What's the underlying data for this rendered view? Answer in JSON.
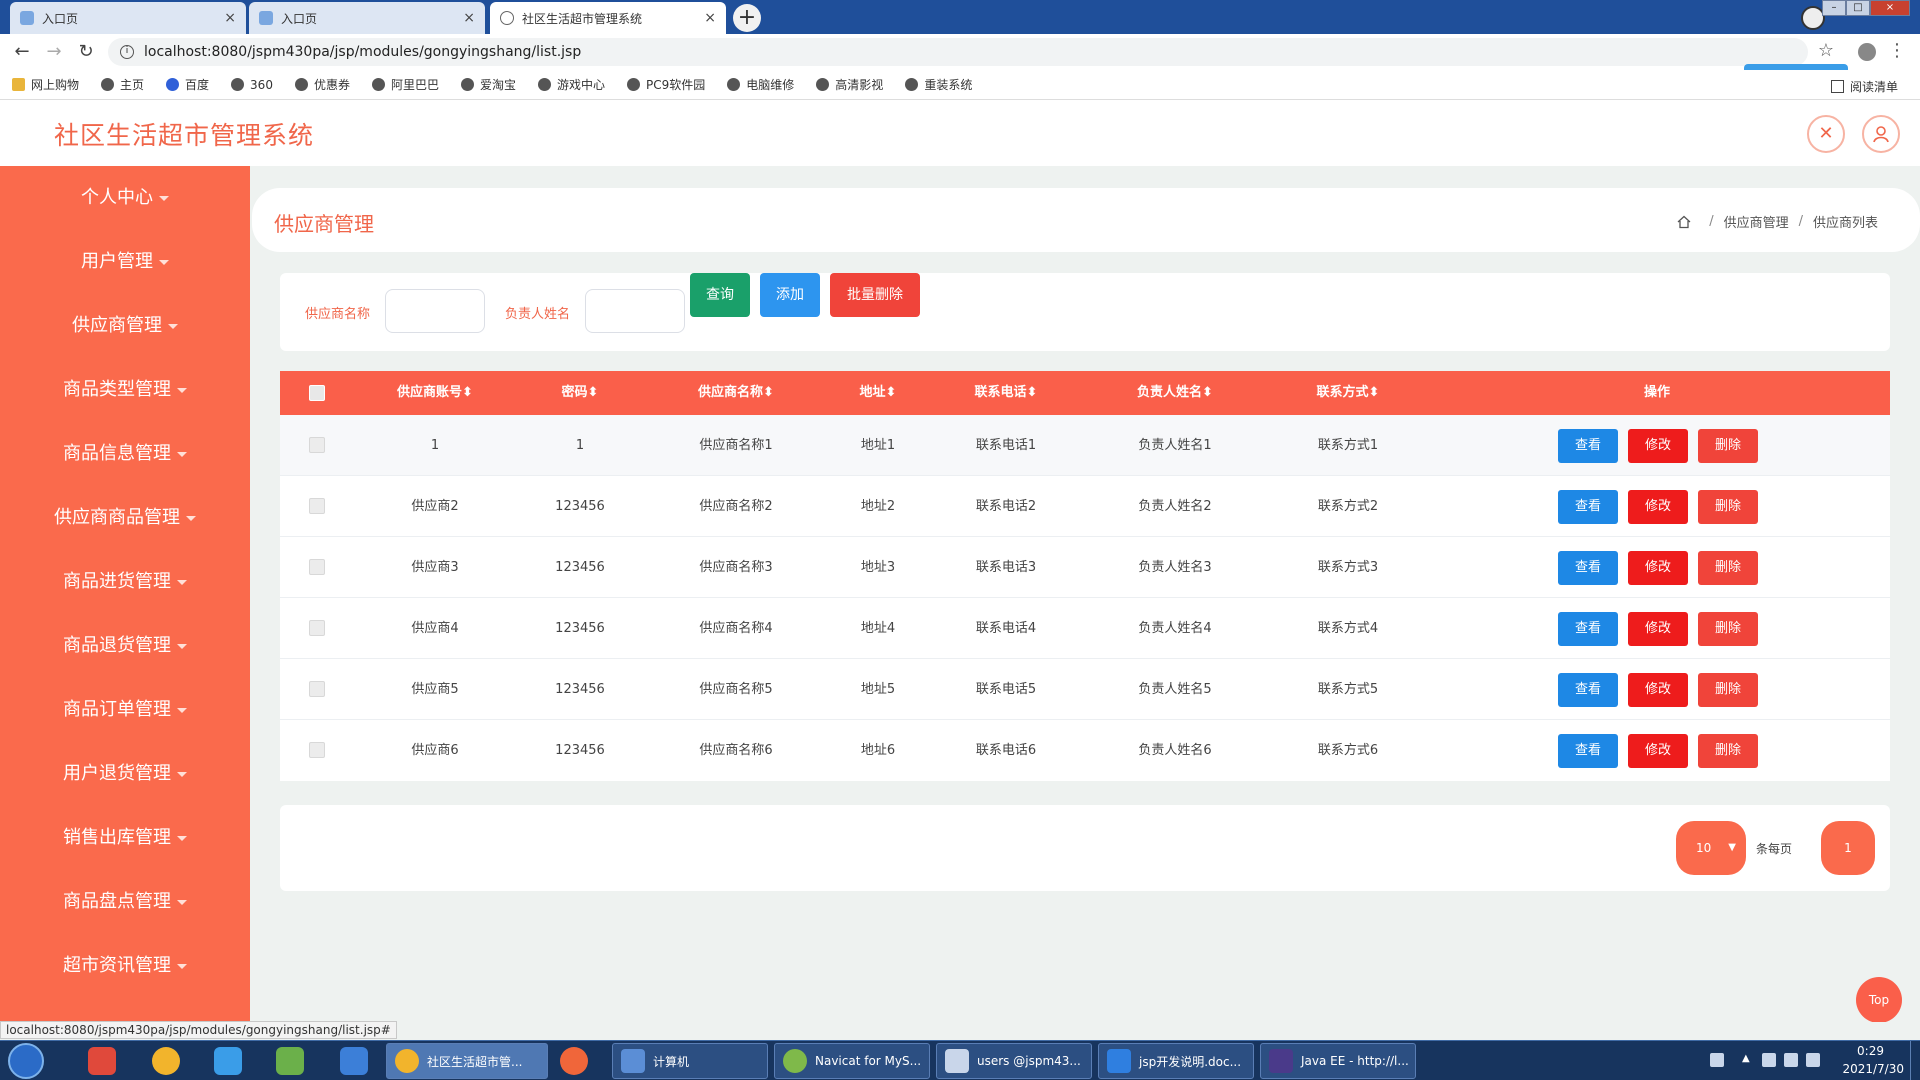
{
  "browser": {
    "tabs": [
      {
        "title": "入口页"
      },
      {
        "title": "入口页"
      },
      {
        "title": "社区生活超市管理系统"
      }
    ],
    "close_glyph": "×",
    "newtab_glyph": "+",
    "url": "localhost:8080/jspm430pa/jsp/modules/gongyingshang/list.jsp",
    "bookmarks": [
      "网上购物",
      "主页",
      "百度",
      "360",
      "优惠券",
      "阿里巴巴",
      "爱淘宝",
      "游戏中心",
      "PC9软件园",
      "电脑维修",
      "高清影视",
      "重装系统"
    ],
    "reading_list": "阅读清单",
    "status_url": "localhost:8080/jspm430pa/jsp/modules/gongyingshang/list.jsp#"
  },
  "app": {
    "title": "社区生活超市管理系统",
    "accent_color": "#fa6a4c",
    "menu": [
      "个人中心",
      "用户管理",
      "供应商管理",
      "商品类型管理",
      "商品信息管理",
      "供应商商品管理",
      "商品进货管理",
      "商品退货管理",
      "商品订单管理",
      "用户退货管理",
      "销售出库管理",
      "商品盘点管理",
      "超市资讯管理"
    ],
    "page_title": "供应商管理",
    "breadcrumb": [
      "供应商管理",
      "供应商列表"
    ],
    "search": {
      "name_label": "供应商名称",
      "name_value": "",
      "contact_label": "负责人姓名",
      "contact_value": "",
      "query_button": "查询",
      "add_button": "添加",
      "batch_delete_button": "批量删除"
    },
    "table": {
      "columns": [
        "供应商账号",
        "密码",
        "供应商名称",
        "地址",
        "联系电话",
        "负责人姓名",
        "联系方式",
        "操作"
      ],
      "sort_glyph": "⬍",
      "rows": [
        [
          "1",
          "1",
          "供应商名称1",
          "地址1",
          "联系电话1",
          "负责人姓名1",
          "联系方式1"
        ],
        [
          "供应商2",
          "123456",
          "供应商名称2",
          "地址2",
          "联系电话2",
          "负责人姓名2",
          "联系方式2"
        ],
        [
          "供应商3",
          "123456",
          "供应商名称3",
          "地址3",
          "联系电话3",
          "负责人姓名3",
          "联系方式3"
        ],
        [
          "供应商4",
          "123456",
          "供应商名称4",
          "地址4",
          "联系电话4",
          "负责人姓名4",
          "联系方式4"
        ],
        [
          "供应商5",
          "123456",
          "供应商名称5",
          "地址5",
          "联系电话5",
          "负责人姓名5",
          "联系方式5"
        ],
        [
          "供应商6",
          "123456",
          "供应商名称6",
          "地址6",
          "联系电话6",
          "负责人姓名6",
          "联系方式6"
        ]
      ],
      "row_actions": [
        "查看",
        "修改",
        "删除"
      ]
    },
    "pagination": {
      "page_size": "10",
      "per_page_label": "条每页",
      "current_page": "1"
    },
    "top_button": "Top"
  },
  "taskbar": {
    "tasks": [
      "社区生活超市管...",
      "计算机",
      "Navicat for MyS...",
      "users @jspm43...",
      "jsp开发说明.doc...",
      "Java EE - http://l..."
    ],
    "time": "0:29",
    "date": "2021/7/30"
  }
}
